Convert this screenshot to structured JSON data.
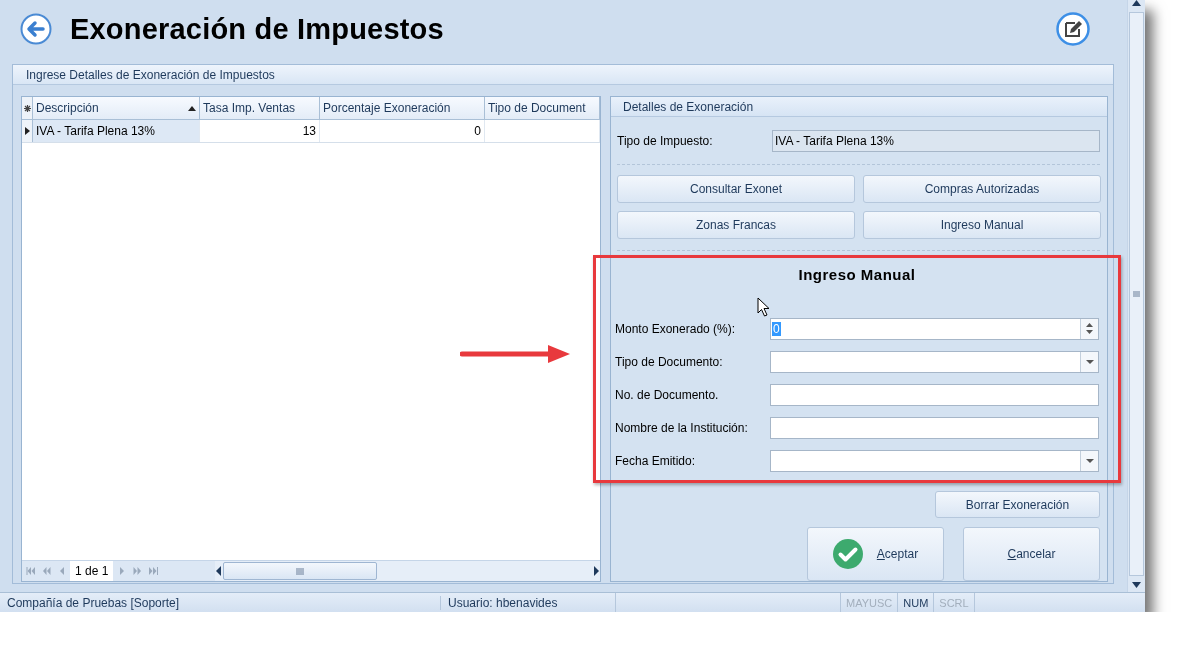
{
  "header": {
    "title": "Exoneración de Impuestos"
  },
  "group": {
    "title": "Ingrese Detalles de Exoneración de Impuestos"
  },
  "table": {
    "columns": [
      {
        "label": "Descripción",
        "sorted_ascending": true
      },
      {
        "label": "Tasa Imp. Ventas",
        "sorted_ascending": false
      },
      {
        "label": "Porcentaje Exoneración",
        "sorted_ascending": false
      },
      {
        "label": "Tipo de Document",
        "sorted_ascending": false
      }
    ],
    "rows": [
      {
        "selected": true,
        "cells": [
          "IVA - Tarifa Plena 13%",
          "13",
          "0"
        ]
      }
    ]
  },
  "pager": {
    "text": "1 de 1"
  },
  "details": {
    "title": "Detalles de Exoneración",
    "tax_type": {
      "label": "Tipo de Impuesto:",
      "value": "IVA - Tarifa Plena 13%"
    },
    "buttons": [
      "Consultar Exonet",
      "Compras Autorizadas",
      "Zonas Francas",
      "Ingreso Manual"
    ],
    "manual": {
      "title": "Ingreso Manual",
      "fields": [
        {
          "label": "Monto Exonerado (%):",
          "kind": "spin",
          "value": "0"
        },
        {
          "label": "Tipo de Documento:",
          "kind": "combo"
        },
        {
          "label": "No. de Documento.",
          "kind": "text"
        },
        {
          "label": "Nombre de la Institución:",
          "kind": "text"
        },
        {
          "label": "Fecha Emitido:",
          "kind": "combo"
        }
      ]
    },
    "clear_button": "Borrar Exoneración",
    "actions": [
      {
        "label": "Aceptar",
        "kind": "confirm"
      },
      {
        "label": "Cancelar",
        "kind": "cancel"
      }
    ]
  },
  "status_bar": {
    "company": "Compañía de Pruebas [Soporte]",
    "user": "Usuario: hbenavides",
    "indicators": [
      {
        "label": "MAYUSC",
        "on": false
      },
      {
        "label": "NUM",
        "on": true
      },
      {
        "label": "SCRL",
        "on": false
      }
    ]
  }
}
